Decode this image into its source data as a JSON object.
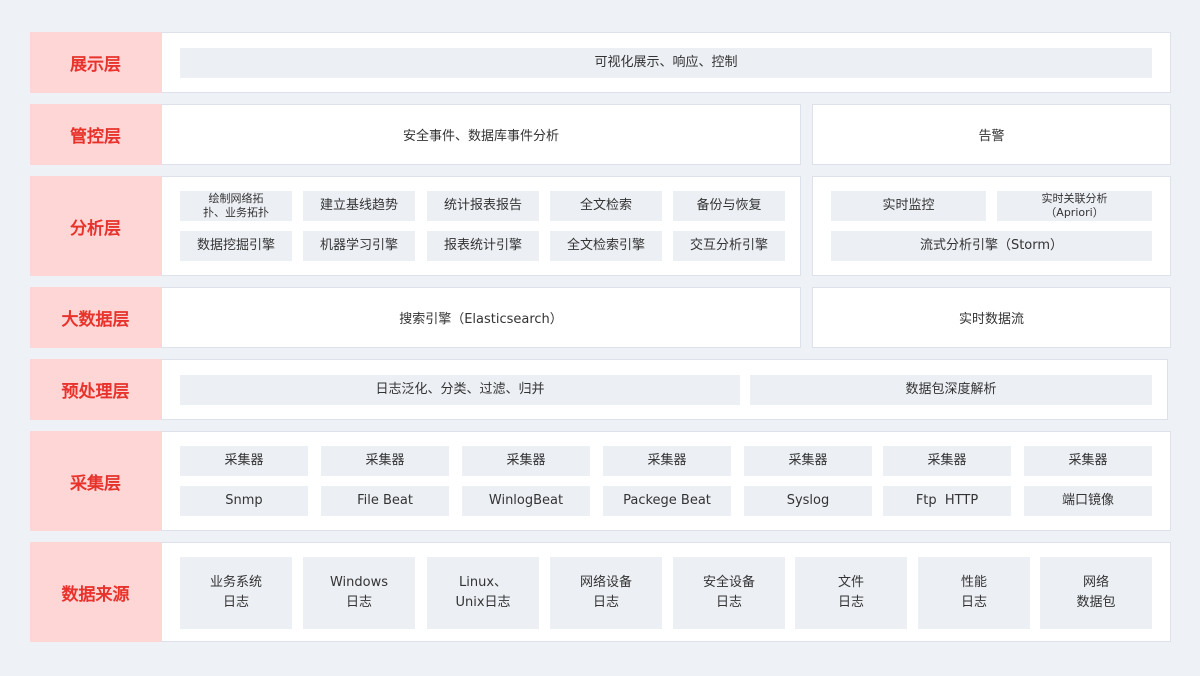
{
  "layers": {
    "display": {
      "label": "展示层",
      "item": "可视化展示、响应、控制"
    },
    "control": {
      "label": "管控层",
      "main": "安全事件、数据库事件分析",
      "side": "告警"
    },
    "analysis": {
      "label": "分析层",
      "row1": [
        "绘制网络拓\n扑、业务拓扑",
        "建立基线趋势",
        "统计报表报告",
        "全文检索",
        "备份与恢复"
      ],
      "row2": [
        "数据挖掘引擎",
        "机器学习引擎",
        "报表统计引擎",
        "全文检索引擎",
        "交互分析引擎"
      ],
      "side_row1": [
        "实时监控",
        "实时关联分析\n（Apriori）"
      ],
      "side_row2": "流式分析引擎（Storm）"
    },
    "bigdata": {
      "label": "大数据层",
      "main": "搜索引擎（Elasticsearch）",
      "side": "实时数据流"
    },
    "preprocess": {
      "label": "预处理层",
      "left": "日志泛化、分类、过滤、归并",
      "right": "数据包深度解析"
    },
    "collection": {
      "label": "采集层",
      "row1": [
        "采集器",
        "采集器",
        "采集器",
        "采集器",
        "采集器",
        "采集器",
        "采集器"
      ],
      "row2": [
        "Snmp",
        "File Beat",
        "WinlogBeat",
        "Packege Beat",
        "Syslog",
        "Ftp  HTTP",
        "端口镜像"
      ]
    },
    "sources": {
      "label": "数据来源",
      "items": [
        [
          "业务系统",
          "日志"
        ],
        [
          "Windows",
          "日志"
        ],
        [
          "Linux、",
          "Unix日志"
        ],
        [
          "网络设备",
          "日志"
        ],
        [
          "安全设备",
          "日志"
        ],
        [
          "文件",
          "日志"
        ],
        [
          "性能",
          "日志"
        ],
        [
          "网络",
          "数据包"
        ]
      ]
    }
  }
}
